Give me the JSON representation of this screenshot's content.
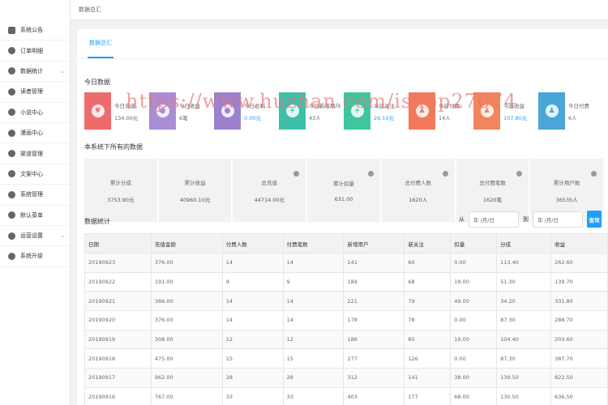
{
  "sidebar": {
    "items": [
      {
        "label": "系统公告",
        "icon": "speaker-icon",
        "has_children": false
      },
      {
        "label": "订单明细",
        "icon": "settings-icon",
        "has_children": false
      },
      {
        "label": "数据统计",
        "icon": "settings-icon",
        "has_children": true
      },
      {
        "label": "读者管理",
        "icon": "reader-icon",
        "has_children": false
      },
      {
        "label": "小说中心",
        "icon": "novel-icon",
        "has_children": false
      },
      {
        "label": "漫画中心",
        "icon": "comic-icon",
        "has_children": false
      },
      {
        "label": "渠道管理",
        "icon": "channel-icon",
        "has_children": false
      },
      {
        "label": "文案中心",
        "icon": "copywriting-icon",
        "has_children": false
      },
      {
        "label": "系统管理",
        "icon": "settings-icon",
        "has_children": false
      },
      {
        "label": "默认菜单",
        "icon": "settings-icon",
        "has_children": false
      },
      {
        "label": "运营设置",
        "icon": "settings-icon",
        "has_children": true
      },
      {
        "label": "系统升级",
        "icon": "upgrade-icon",
        "has_children": false
      }
    ]
  },
  "topbar": {
    "title": "数据总汇"
  },
  "tabs": [
    {
      "label": "数据总汇",
      "active": true
    }
  ],
  "today": {
    "title": "今日数据",
    "cards": [
      {
        "label": "今日充值",
        "value": "134.00元",
        "icon": "yen-icon",
        "color": "#ee6b6b",
        "text_color": "#666666"
      },
      {
        "label": "今日收益",
        "value": "6笔",
        "icon": "coins-icon",
        "color": "#a98ed6",
        "text_color": "#666666"
      },
      {
        "label": "今日总利",
        "value": "0.00元",
        "icon": "coins-icon",
        "color": "#9b80cf",
        "text_color": "#1e9fff"
      },
      {
        "label": "今日新增用户",
        "value": "43人",
        "icon": "user-add-icon",
        "color": "#3fbfa8",
        "text_color": "#666666"
      },
      {
        "label": "今日关注",
        "value": "26.10元",
        "icon": "user-add-icon",
        "color": "#3dc6a0",
        "text_color": "#1e9fff"
      },
      {
        "label": "今日付费",
        "value": "14人",
        "icon": "user-icon",
        "color": "#f27a5a",
        "text_color": "#666666"
      },
      {
        "label": "今日收益",
        "value": "107.80元",
        "icon": "user-icon",
        "color": "#f2855e",
        "text_color": "#1e9fff"
      },
      {
        "label": "今日付费",
        "value": "6人",
        "icon": "user-icon",
        "color": "#4aa6d6",
        "text_color": "#666666"
      }
    ]
  },
  "totals": {
    "title": "本系统下所有的数据",
    "items": [
      {
        "label": "累计分成",
        "value": "3753.90元",
        "has_info": false
      },
      {
        "label": "累计收益",
        "value": "40960.10元",
        "has_info": false
      },
      {
        "label": "总充值",
        "value": "44714.00元",
        "has_info": true
      },
      {
        "label": "累计扣量",
        "value": "631.00",
        "has_info": true
      },
      {
        "label": "总付费人数",
        "value": "1620人",
        "has_info": true
      },
      {
        "label": "总付费笔数",
        "value": "1620笔",
        "has_info": true
      },
      {
        "label": "累计用户数",
        "value": "36535人",
        "has_info": true
      }
    ]
  },
  "stats": {
    "title": "数据统计",
    "from_label": "从",
    "to_label": "到",
    "date_placeholder": "年 /月/日",
    "query_label": "查询",
    "columns": [
      "日期",
      "充值金额",
      "付费人数",
      "付费笔数",
      "新增用户",
      "新关注",
      "扣量",
      "分成",
      "收益"
    ],
    "rows": [
      [
        "20190923",
        "376.00",
        "14",
        "14",
        "141",
        "60",
        "0.00",
        "113.40",
        "262.60"
      ],
      [
        "20190922",
        "191.00",
        "9",
        "9",
        "184",
        "68",
        "19.00",
        "51.30",
        "139.70"
      ],
      [
        "20190921",
        "366.00",
        "14",
        "14",
        "221",
        "79",
        "49.00",
        "34.20",
        "331.80"
      ],
      [
        "20190920",
        "376.00",
        "14",
        "14",
        "178",
        "78",
        "0.00",
        "87.30",
        "288.70"
      ],
      [
        "20190919",
        "308.00",
        "12",
        "12",
        "186",
        "85",
        "19.00",
        "104.40",
        "203.60"
      ],
      [
        "20190918",
        "475.00",
        "15",
        "15",
        "277",
        "126",
        "0.00",
        "87.30",
        "387.70"
      ],
      [
        "20190917",
        "962.00",
        "28",
        "28",
        "312",
        "141",
        "38.00",
        "139.50",
        "822.50"
      ],
      [
        "20190916",
        "767.00",
        "33",
        "33",
        "403",
        "177",
        "68.00",
        "130.50",
        "636.50"
      ]
    ]
  },
  "watermark": "https://www.huzhan.com/ishop27674",
  "colors": {
    "accent": "#1e9fff",
    "panel_bg": "#f2f2f2"
  }
}
